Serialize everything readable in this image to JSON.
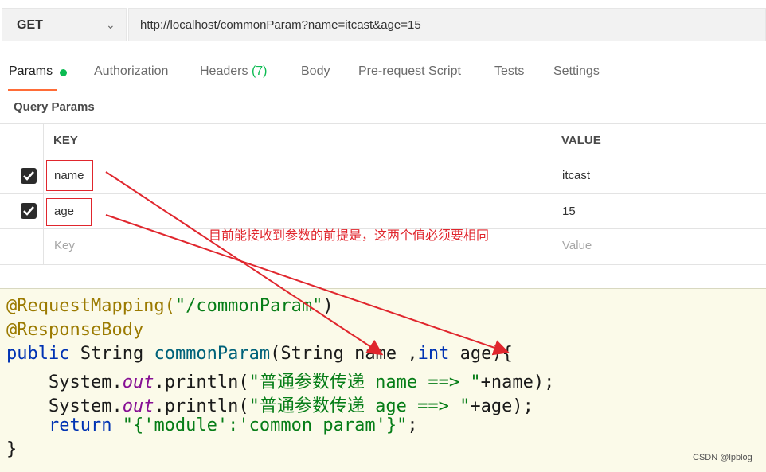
{
  "request": {
    "method": "GET",
    "url": "http://localhost/commonParam?name=itcast&age=15"
  },
  "tabs": {
    "params": "Params",
    "authorization": "Authorization",
    "headers": "Headers",
    "headers_count": "(7)",
    "body": "Body",
    "pre_request_script": "Pre-request Script",
    "tests": "Tests",
    "settings": "Settings"
  },
  "query_params": {
    "label": "Query Params",
    "key_header": "KEY",
    "value_header": "VALUE",
    "rows": [
      {
        "key": "name",
        "value": "itcast",
        "checked": true
      },
      {
        "key": "age",
        "value": "15",
        "checked": true
      }
    ],
    "key_placeholder": "Key",
    "value_placeholder": "Value"
  },
  "annotation": "目前能接收到参数的前提是，这两个值必须要相同",
  "code": {
    "l1_ann": "@RequestMapping(",
    "l1_str": "\"/commonParam\"",
    "l1_end": ")",
    "l2_ann": "@ResponseBody",
    "l3_kw": "public",
    "l3_a": " String ",
    "l3_fn": "commonParam",
    "l3_b": "(String name ,",
    "l3_kw2": "int",
    "l3_c": " age){",
    "l4_a": "    System.",
    "l4_fld": "out",
    "l4_b": ".println(",
    "l4_str": "\"普通参数传递 name ==> \"",
    "l4_c": "+name);",
    "l5_a": "    System.",
    "l5_fld": "out",
    "l5_b": ".println(",
    "l5_str": "\"普通参数传递 age ==> \"",
    "l5_c": "+age);",
    "l6_kw": "    return",
    "l6_sp": " ",
    "l6_str": "\"{'module':'common param'}\"",
    "l6_c": ";",
    "l7": "}"
  },
  "watermark": "CSDN @lpblog",
  "colors": {
    "accent_tab": "#ff6c37",
    "params_dot": "#0cbb52",
    "annotation_red": "#e0262d",
    "code_bg": "#fbfae9"
  }
}
